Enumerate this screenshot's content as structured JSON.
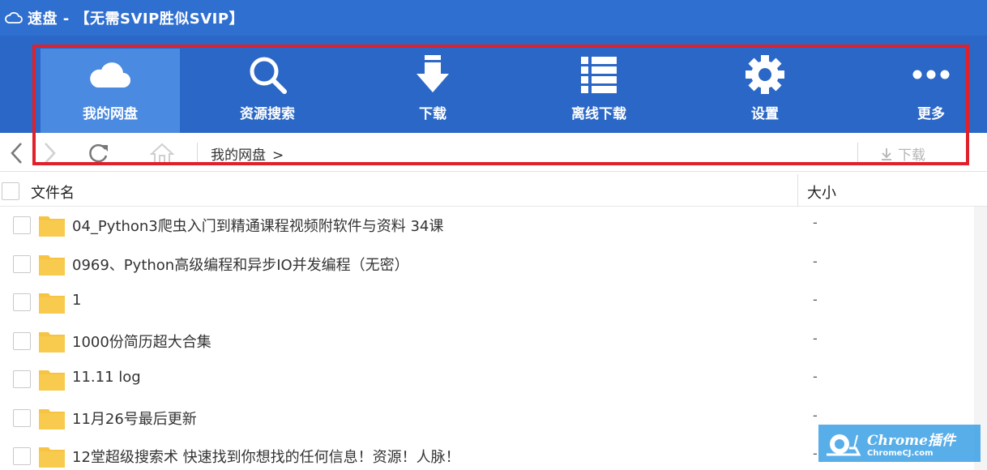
{
  "window": {
    "title": "速盘 - 【无需SVIP胜似SVIP】"
  },
  "toolbar": {
    "items": [
      {
        "label": "我的网盘",
        "icon": "cloud-icon",
        "active": true
      },
      {
        "label": "资源搜索",
        "icon": "search-icon",
        "active": false
      },
      {
        "label": "下载",
        "icon": "download-icon",
        "active": false
      },
      {
        "label": "离线下载",
        "icon": "list-icon",
        "active": false
      },
      {
        "label": "设置",
        "icon": "gear-icon",
        "active": false
      },
      {
        "label": "更多",
        "icon": "more-icon",
        "active": false
      }
    ]
  },
  "nav": {
    "breadcrumb": "我的网盘",
    "breadcrumb_arrow": ">",
    "download_label": "下载"
  },
  "table": {
    "columns": {
      "name": "文件名",
      "size": "大小"
    },
    "rows": [
      {
        "name": "04_Python3爬虫入门到精通课程视频附软件与资料 34课",
        "size": "-"
      },
      {
        "name": "0969、Python高级编程和异步IO并发编程（无密）",
        "size": "-"
      },
      {
        "name": "1",
        "size": "-"
      },
      {
        "name": "1000份简历超大合集",
        "size": "-"
      },
      {
        "name": "11.11 log",
        "size": "-"
      },
      {
        "name": "11月26号最后更新",
        "size": "-"
      },
      {
        "name": "12堂超级搜索术 快速找到你想找的任何信息！资源！人脉！",
        "size": "-"
      }
    ]
  },
  "watermark": {
    "main": "Chrome插件",
    "sub": "ChromeCJ.com"
  },
  "colors": {
    "titlebar": "#2f6fcf",
    "toolbar": "#2a67c6",
    "active_tab": "#4a8ae0",
    "highlight": "#e0202a",
    "folder": "#f6c343"
  }
}
